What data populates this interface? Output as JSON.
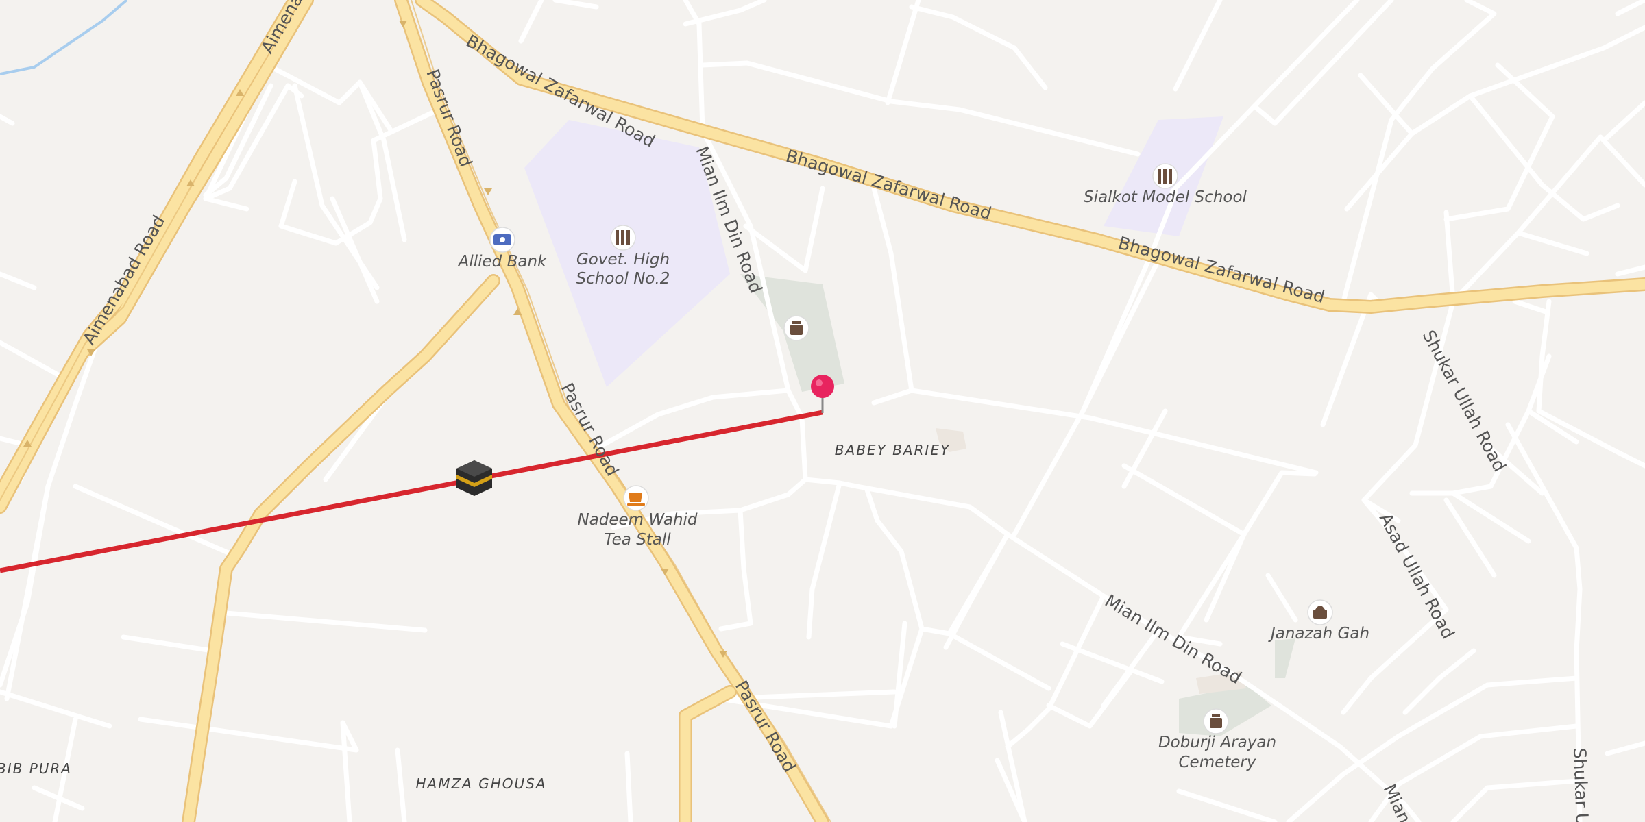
{
  "map": {
    "roads": {
      "aimenabad_road": "Aimenabad Road",
      "aimenabad_road_partial": "Aimena",
      "pasrur_road": "Pasrur Road",
      "bhagowal_zafarwal_road": "Bhagowal Zafarwal Road",
      "mian_ilm_din_road": "Mian Ilm Din Road",
      "mian_partial": "Mian",
      "shukar_ullah_road": "Shukar Ullah Road",
      "shukar_partial": "Shukar U",
      "asad_ullah_road": "Asad Ullah Road"
    },
    "pois": {
      "allied_bank": "Allied Bank",
      "govt_school_line1": "Govet. High",
      "govt_school_line2": "School No.2",
      "sialkot_model_school": "Sialkot Model School",
      "nadeem_tea_line1": "Nadeem Wahid",
      "nadeem_tea_line2": "Tea Stall",
      "janazah_gah": "Janazah Gah",
      "doburji_line1": "Doburji Arayan",
      "doburji_line2": "Cemetery"
    },
    "areas": {
      "babey_bariey": "BABEY BARIEY",
      "bib_pura": "BIB PURA",
      "hamza_ghousa": "HAMZA GHOUSA"
    },
    "colors": {
      "background": "#f4f2ef",
      "minor_road": "#ffffff",
      "major_road": "#fbe3a2",
      "major_road_casing": "#e9c27a",
      "school_area": "#ece8f8",
      "green_area": "#dfe3dc",
      "qibla_line": "#d7262e",
      "pin": "#e8245f",
      "water": "#a8cdee"
    },
    "icons": {
      "pin": "location-pin-icon",
      "kaaba": "kaaba-icon",
      "bank": "bank-icon",
      "school": "school-icon",
      "cemetery": "cemetery-icon",
      "cafe": "cafe-icon",
      "mosque": "funeral-prayer-icon"
    }
  }
}
